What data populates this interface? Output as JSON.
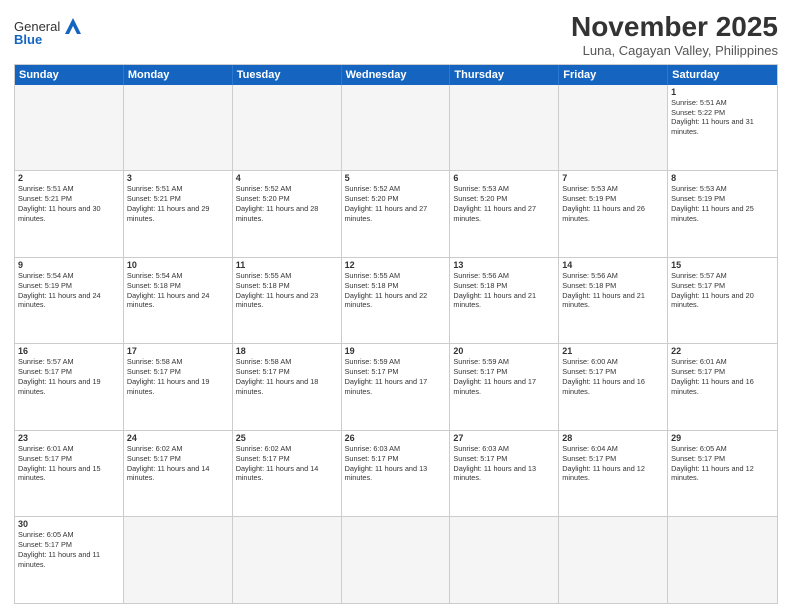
{
  "header": {
    "logo": {
      "general": "General",
      "blue": "Blue"
    },
    "title": "November 2025",
    "subtitle": "Luna, Cagayan Valley, Philippines"
  },
  "days": [
    "Sunday",
    "Monday",
    "Tuesday",
    "Wednesday",
    "Thursday",
    "Friday",
    "Saturday"
  ],
  "weeks": [
    [
      {
        "day": null,
        "empty": true
      },
      {
        "day": null,
        "empty": true
      },
      {
        "day": null,
        "empty": true
      },
      {
        "day": null,
        "empty": true
      },
      {
        "day": null,
        "empty": true
      },
      {
        "day": null,
        "empty": true
      },
      {
        "day": 1,
        "sunrise": "5:51 AM",
        "sunset": "5:22 PM",
        "daylight": "11 hours and 31 minutes."
      }
    ],
    [
      {
        "day": 2,
        "sunrise": "5:51 AM",
        "sunset": "5:21 PM",
        "daylight": "11 hours and 30 minutes."
      },
      {
        "day": 3,
        "sunrise": "5:51 AM",
        "sunset": "5:21 PM",
        "daylight": "11 hours and 29 minutes."
      },
      {
        "day": 4,
        "sunrise": "5:52 AM",
        "sunset": "5:20 PM",
        "daylight": "11 hours and 28 minutes."
      },
      {
        "day": 5,
        "sunrise": "5:52 AM",
        "sunset": "5:20 PM",
        "daylight": "11 hours and 27 minutes."
      },
      {
        "day": 6,
        "sunrise": "5:53 AM",
        "sunset": "5:20 PM",
        "daylight": "11 hours and 27 minutes."
      },
      {
        "day": 7,
        "sunrise": "5:53 AM",
        "sunset": "5:19 PM",
        "daylight": "11 hours and 26 minutes."
      },
      {
        "day": 8,
        "sunrise": "5:53 AM",
        "sunset": "5:19 PM",
        "daylight": "11 hours and 25 minutes."
      }
    ],
    [
      {
        "day": 9,
        "sunrise": "5:54 AM",
        "sunset": "5:19 PM",
        "daylight": "11 hours and 24 minutes."
      },
      {
        "day": 10,
        "sunrise": "5:54 AM",
        "sunset": "5:18 PM",
        "daylight": "11 hours and 24 minutes."
      },
      {
        "day": 11,
        "sunrise": "5:55 AM",
        "sunset": "5:18 PM",
        "daylight": "11 hours and 23 minutes."
      },
      {
        "day": 12,
        "sunrise": "5:55 AM",
        "sunset": "5:18 PM",
        "daylight": "11 hours and 22 minutes."
      },
      {
        "day": 13,
        "sunrise": "5:56 AM",
        "sunset": "5:18 PM",
        "daylight": "11 hours and 21 minutes."
      },
      {
        "day": 14,
        "sunrise": "5:56 AM",
        "sunset": "5:18 PM",
        "daylight": "11 hours and 21 minutes."
      },
      {
        "day": 15,
        "sunrise": "5:57 AM",
        "sunset": "5:17 PM",
        "daylight": "11 hours and 20 minutes."
      }
    ],
    [
      {
        "day": 16,
        "sunrise": "5:57 AM",
        "sunset": "5:17 PM",
        "daylight": "11 hours and 19 minutes."
      },
      {
        "day": 17,
        "sunrise": "5:58 AM",
        "sunset": "5:17 PM",
        "daylight": "11 hours and 19 minutes."
      },
      {
        "day": 18,
        "sunrise": "5:58 AM",
        "sunset": "5:17 PM",
        "daylight": "11 hours and 18 minutes."
      },
      {
        "day": 19,
        "sunrise": "5:59 AM",
        "sunset": "5:17 PM",
        "daylight": "11 hours and 17 minutes."
      },
      {
        "day": 20,
        "sunrise": "5:59 AM",
        "sunset": "5:17 PM",
        "daylight": "11 hours and 17 minutes."
      },
      {
        "day": 21,
        "sunrise": "6:00 AM",
        "sunset": "5:17 PM",
        "daylight": "11 hours and 16 minutes."
      },
      {
        "day": 22,
        "sunrise": "6:01 AM",
        "sunset": "5:17 PM",
        "daylight": "11 hours and 16 minutes."
      }
    ],
    [
      {
        "day": 23,
        "sunrise": "6:01 AM",
        "sunset": "5:17 PM",
        "daylight": "11 hours and 15 minutes."
      },
      {
        "day": 24,
        "sunrise": "6:02 AM",
        "sunset": "5:17 PM",
        "daylight": "11 hours and 14 minutes."
      },
      {
        "day": 25,
        "sunrise": "6:02 AM",
        "sunset": "5:17 PM",
        "daylight": "11 hours and 14 minutes."
      },
      {
        "day": 26,
        "sunrise": "6:03 AM",
        "sunset": "5:17 PM",
        "daylight": "11 hours and 13 minutes."
      },
      {
        "day": 27,
        "sunrise": "6:03 AM",
        "sunset": "5:17 PM",
        "daylight": "11 hours and 13 minutes."
      },
      {
        "day": 28,
        "sunrise": "6:04 AM",
        "sunset": "5:17 PM",
        "daylight": "11 hours and 12 minutes."
      },
      {
        "day": 29,
        "sunrise": "6:05 AM",
        "sunset": "5:17 PM",
        "daylight": "11 hours and 12 minutes."
      }
    ],
    [
      {
        "day": 30,
        "sunrise": "6:05 AM",
        "sunset": "5:17 PM",
        "daylight": "11 hours and 11 minutes."
      },
      {
        "day": null,
        "empty": true
      },
      {
        "day": null,
        "empty": true
      },
      {
        "day": null,
        "empty": true
      },
      {
        "day": null,
        "empty": true
      },
      {
        "day": null,
        "empty": true
      },
      {
        "day": null,
        "empty": true
      }
    ]
  ]
}
